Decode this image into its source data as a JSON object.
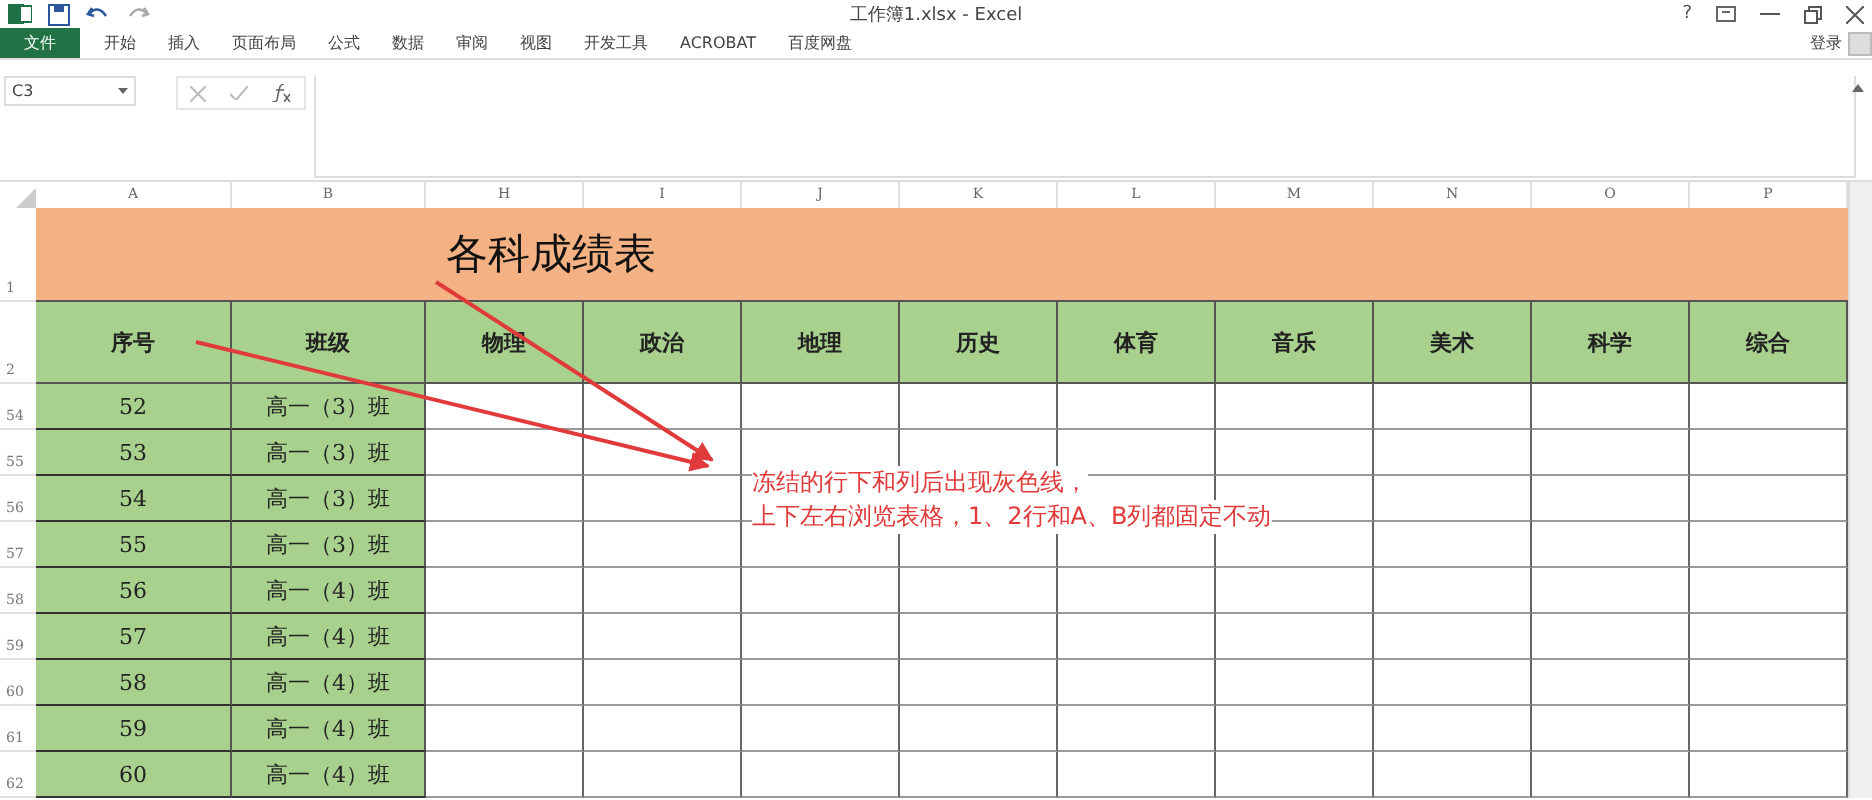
{
  "window": {
    "title": "工作簿1.xlsx - Excel",
    "help": "?",
    "sign_in": "登录"
  },
  "ribbon_tabs": [
    {
      "label": "文件",
      "kind": "file"
    },
    {
      "label": "开始",
      "kind": "tab"
    },
    {
      "label": "插入",
      "kind": "tab"
    },
    {
      "label": "页面布局",
      "kind": "tab"
    },
    {
      "label": "公式",
      "kind": "tab"
    },
    {
      "label": "数据",
      "kind": "tab"
    },
    {
      "label": "审阅",
      "kind": "tab"
    },
    {
      "label": "视图",
      "kind": "tab"
    },
    {
      "label": "开发工具",
      "kind": "tab"
    },
    {
      "label": "ACROBAT",
      "kind": "tab"
    },
    {
      "label": "百度网盘",
      "kind": "tab"
    }
  ],
  "name_box": "C3",
  "columns": [
    "A",
    "B",
    "H",
    "I",
    "J",
    "K",
    "L",
    "M",
    "N",
    "O",
    "P"
  ],
  "title_row": {
    "number": "1",
    "title": "各科成绩表"
  },
  "header_row": {
    "number": "2",
    "cells": [
      "序号",
      "班级",
      "物理",
      "政治",
      "地理",
      "历史",
      "体育",
      "音乐",
      "美术",
      "科学",
      "综合"
    ]
  },
  "rows": [
    {
      "number": "54",
      "id": "52",
      "class": "高一（3）班"
    },
    {
      "number": "55",
      "id": "53",
      "class": "高一（3）班"
    },
    {
      "number": "56",
      "id": "54",
      "class": "高一（3）班"
    },
    {
      "number": "57",
      "id": "55",
      "class": "高一（3）班"
    },
    {
      "number": "58",
      "id": "56",
      "class": "高一（4）班"
    },
    {
      "number": "59",
      "id": "57",
      "class": "高一（4）班"
    },
    {
      "number": "60",
      "id": "58",
      "class": "高一（4）班"
    },
    {
      "number": "61",
      "id": "59",
      "class": "高一（4）班"
    },
    {
      "number": "62",
      "id": "60",
      "class": "高一（4）班"
    }
  ],
  "annotation": {
    "lines": [
      "冻结的行下和列后出现灰色线，",
      "上下左右浏览表格，1、2行和A、B列都固定不动"
    ]
  }
}
